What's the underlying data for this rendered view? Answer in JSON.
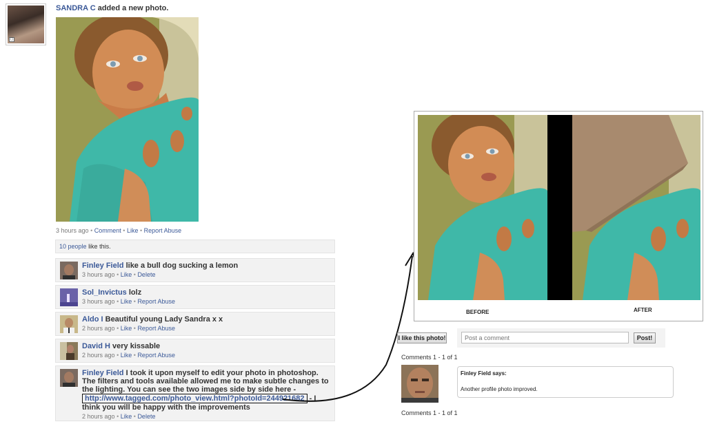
{
  "post": {
    "author": "SANDRA C",
    "action": "added a new photo.",
    "meta": {
      "time": "3 hours ago",
      "comment": "Comment",
      "like": "Like",
      "report": "Report Abuse"
    },
    "likes": {
      "count_link": "10 people",
      "suffix": "like this."
    }
  },
  "comments": [
    {
      "name": "Finley Field",
      "text": "like a bull dog sucking a lemon",
      "time": "3 hours ago",
      "a1": "Like",
      "a2": "Delete"
    },
    {
      "name": "Sol_Invictus",
      "text": "lolz",
      "time": "3 hours ago",
      "a1": "Like",
      "a2": "Report Abuse"
    },
    {
      "name": "Aldo I",
      "text": "Beautiful young Lady Sandra x x",
      "time": "2 hours ago",
      "a1": "Like",
      "a2": "Report Abuse"
    },
    {
      "name": "David H",
      "text": "very kissable",
      "time": "2 hours ago",
      "a1": "Like",
      "a2": "Report Abuse"
    },
    {
      "name": "Finley Field",
      "text_before": "I took it upon myself to edit your photo in photoshop. The filters and tools available allowed me to make subtle changes to the lighting. You can see the two images side by side here -",
      "url": "http://www.tagged.com/photo_view.html?photoId=244921682",
      "text_after": "- I think you will be happy with the improvements",
      "time": "2 hours ago",
      "a1": "Like",
      "a2": "Delete"
    }
  ],
  "composite": {
    "before_label": "BEFORE",
    "after_label": "AFTER"
  },
  "right": {
    "like_button": "I like this photo!",
    "comment_placeholder": "Post a comment",
    "post_button": "Post!",
    "count_top": "Comments 1 - 1 of 1",
    "count_bottom": "Comments 1 - 1 of 1",
    "comment_author": "Finley Field says:",
    "comment_text": "Another profile photo improved."
  },
  "colors": {
    "link": "#3b5998",
    "box_bg": "#f2f2f2",
    "top_dress": "#3fb8a8"
  },
  "icons": {
    "arrow": "curved-arrow-icon",
    "photo_indicator": "photo-icon"
  }
}
